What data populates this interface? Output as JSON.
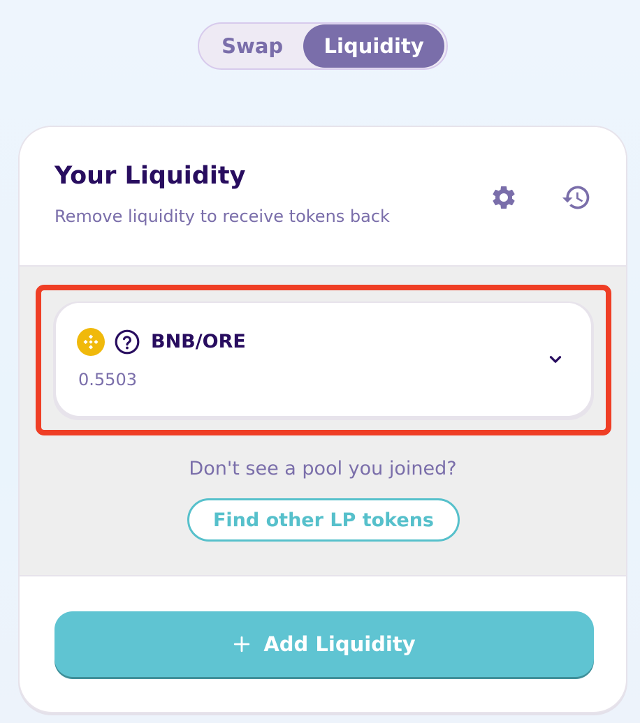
{
  "toggle": {
    "swap_label": "Swap",
    "liquidity_label": "Liquidity",
    "active": "Liquidity"
  },
  "header": {
    "title": "Your Liquidity",
    "subtitle": "Remove liquidity to receive tokens back",
    "icons": [
      "gear-icon",
      "history-icon"
    ]
  },
  "pool": {
    "name": "BNB/ORE",
    "balance": "0.5503",
    "token_icons": [
      "bnb-token-icon",
      "unknown-token-icon"
    ],
    "expand_icon": "chevron-down-icon"
  },
  "footer_hint": {
    "text": "Don't see a pool you joined?",
    "find_label": "Find other LP tokens"
  },
  "add_button": {
    "label": "Add Liquidity",
    "icon": "plus-icon"
  },
  "colors": {
    "primary_text": "#280d5f",
    "secondary_text": "#7a6eaa",
    "accent": "#5fc4d2",
    "highlight": "#ef3e25",
    "bnb": "#f0b90b"
  }
}
